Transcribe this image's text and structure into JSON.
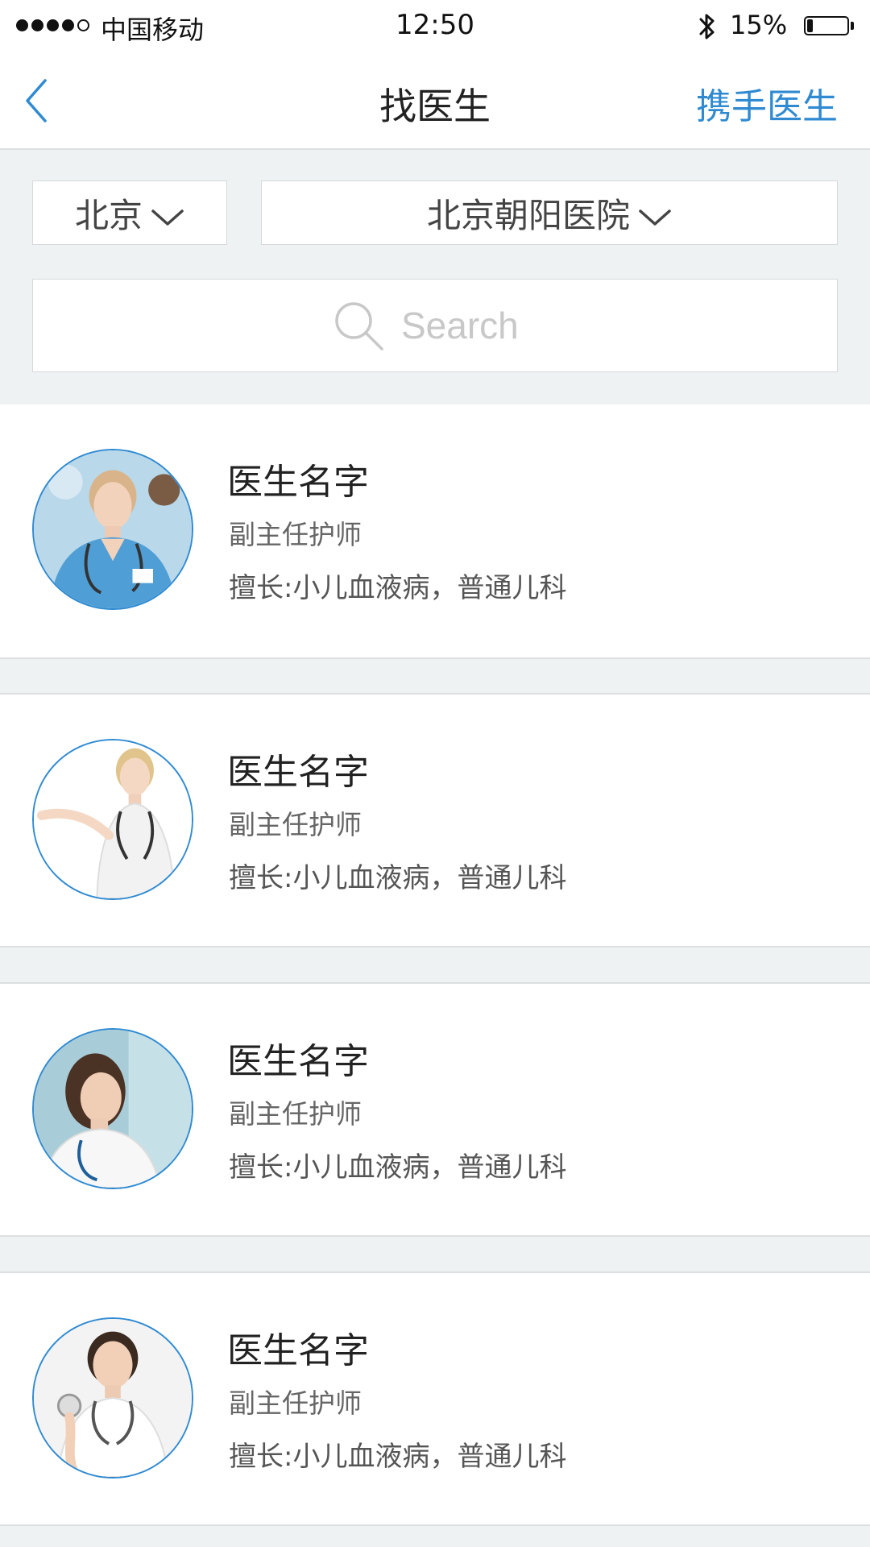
{
  "status_bar": {
    "carrier": "中国移动",
    "time": "12:50",
    "battery": "15%",
    "battery_level": 0.15,
    "signal_bars_filled": 4,
    "signal_bars_total": 5
  },
  "nav": {
    "back_icon": "chevron-left-icon",
    "title": "找医生",
    "right_action": "携手医生"
  },
  "filters": {
    "city": "北京",
    "hospital": "北京朝阳医院",
    "dropdown_icon": "chevron-down-icon"
  },
  "search": {
    "placeholder": "Search",
    "icon": "search-icon"
  },
  "doctors": [
    {
      "name": "医生名字",
      "title": "副主任护师",
      "specialty": "擅长:小儿血液病，普通儿科",
      "avatar_bg": "#b9d8ea",
      "scrub": "#4f9fd6"
    },
    {
      "name": "医生名字",
      "title": "副主任护师",
      "specialty": "擅长:小儿血液病，普通儿科",
      "avatar_bg": "#ffffff",
      "scrub": "#f2f2f2"
    },
    {
      "name": "医生名字",
      "title": "副主任护师",
      "specialty": "擅长:小儿血液病，普通儿科",
      "avatar_bg": "#a9cdd8",
      "scrub": "#f7f7f7"
    },
    {
      "name": "医生名字",
      "title": "副主任护师",
      "specialty": "擅长:小儿血液病，普通儿科",
      "avatar_bg": "#f3f3f3",
      "scrub": "#ffffff"
    }
  ],
  "colors": {
    "accent": "#2f8ad2",
    "background": "#eff2f3",
    "divider": "#dcdfe1"
  }
}
